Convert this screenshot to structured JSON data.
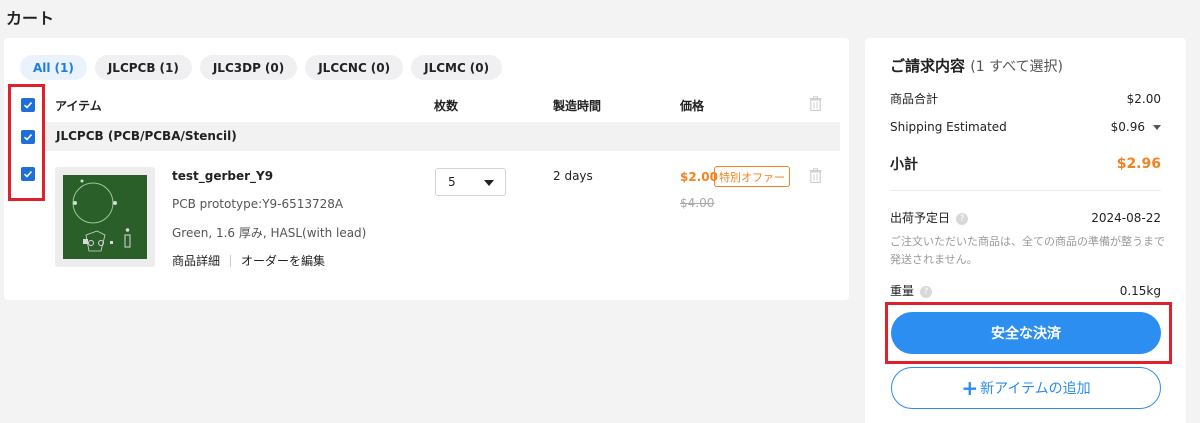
{
  "page": {
    "title": "カート"
  },
  "filters": [
    {
      "label": "All",
      "count": "(1)",
      "active": true
    },
    {
      "label": "JLCPCB",
      "count": "(1)"
    },
    {
      "label": "JLC3DP",
      "count": "(0)"
    },
    {
      "label": "JLCCNC",
      "count": "(0)"
    },
    {
      "label": "JLCMC",
      "count": "(0)"
    }
  ],
  "table": {
    "headers": {
      "item": "アイテム",
      "qty": "枚数",
      "time": "製造時間",
      "price": "価格"
    },
    "group": "JLCPCB (PCB/PCBA/Stencil)"
  },
  "item": {
    "name": "test_gerber_Y9",
    "line1": "PCB prototype:Y9-6513728A",
    "line2": "Green, 1.6 厚み, HASL(with lead)",
    "link_details": "商品詳細",
    "link_edit": "オーダーを編集",
    "qty": "5",
    "build_time": "2 days",
    "price": "$2.00",
    "offer": "特別オファー",
    "old_price": "$4.00"
  },
  "summary": {
    "title": "ご請求内容",
    "title_note": "(1 すべて選択)",
    "goods_label": "商品合計",
    "goods_value": "$2.00",
    "shipping_label": "Shipping Estimated",
    "shipping_value": "$0.96",
    "subtotal_label": "小計",
    "subtotal_value": "$2.96",
    "ship_date_label": "出荷予定日",
    "ship_date_value": "2024-08-22",
    "notice": "ご注文いただいた商品は、全ての商品の準備が整うまで発送されません。",
    "weight_label": "重量",
    "weight_value": "0.15kg",
    "checkout_label": "安全な決済",
    "add_label": "新アイテムの追加",
    "add_icon": "+"
  },
  "colors": {
    "accent": "#2b8ef0",
    "price": "#f58220",
    "highlight": "#e0202a"
  }
}
